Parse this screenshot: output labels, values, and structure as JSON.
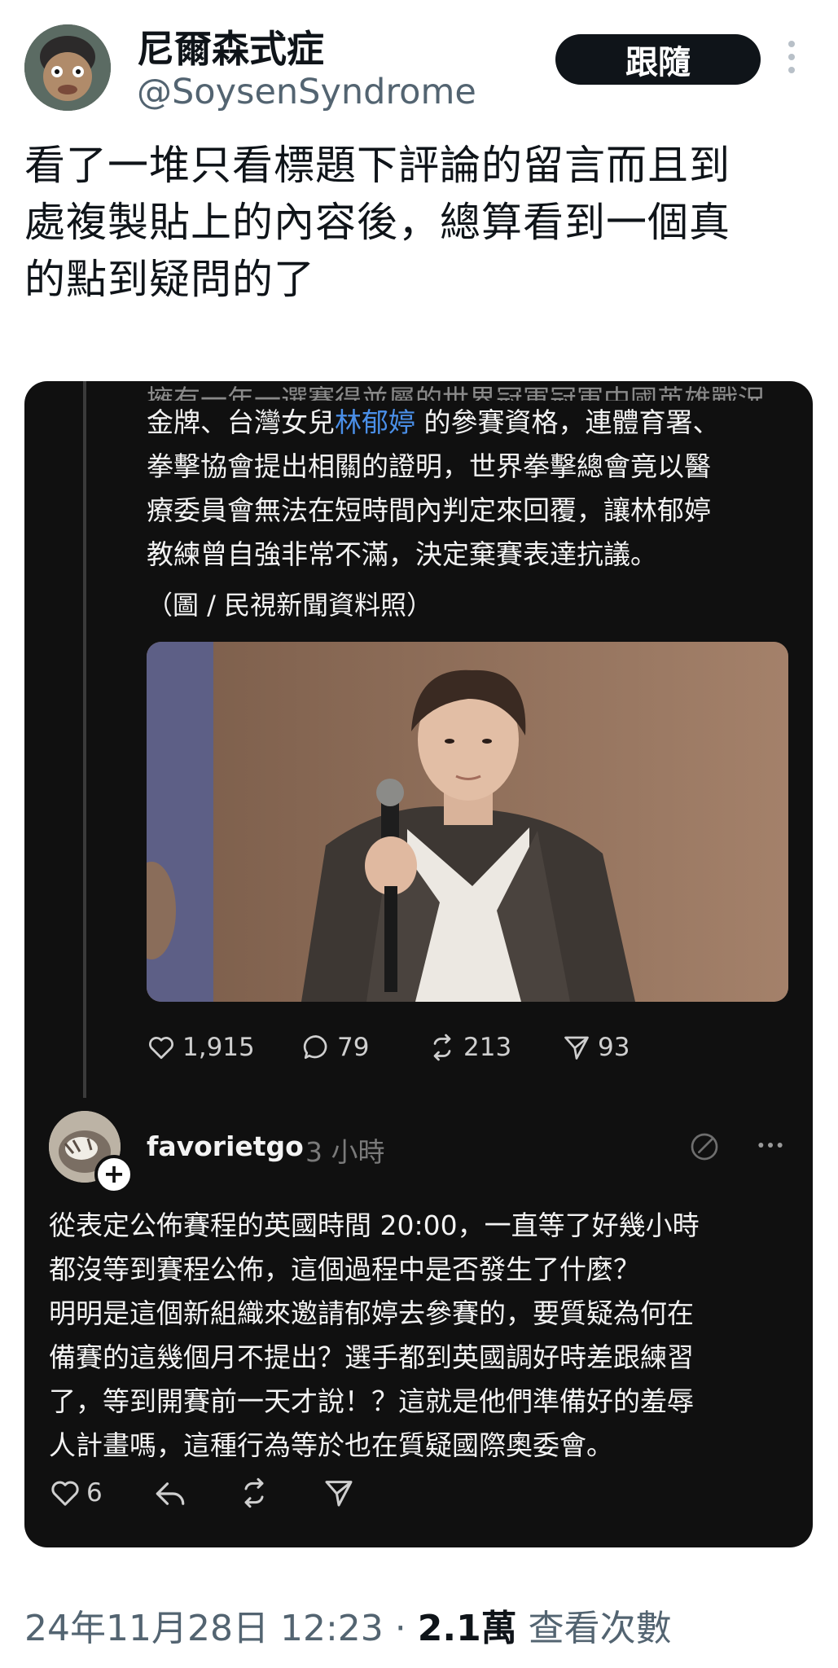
{
  "tweet": {
    "display_name": "尼爾森式症",
    "handle": "@SoysenSyndrome",
    "follow_label": "跟隨",
    "text_lines": [
      "看了一堆只看標題下評論的留言而且到",
      "處複製貼上的內容後，總算看到一個真",
      "的點到疑問的了"
    ]
  },
  "embedded": {
    "post_lines": [
      "金牌、台灣女兒",
      "的參賽資格，連體育署、",
      "拳擊協會提出相關的證明，世界拳擊總會竟以醫",
      "療委員會無法在短時間內判定來回覆，讓林郁婷",
      "教練曾自強非常不滿，決定棄賽表達抗議。"
    ],
    "linked_name": "林郁婷",
    "caption": "（圖 / 民視新聞資料照）",
    "stats": {
      "likes": "1,915",
      "replies": "79",
      "reposts": "213",
      "shares": "93"
    },
    "reply": {
      "username": "favorietgo",
      "time": "3 小時",
      "text_lines": [
        "從表定公佈賽程的英國時間 20:00，一直等了好幾小時",
        "都沒等到賽程公佈，這個過程中是否發生了什麼？",
        "明明是這個新組織來邀請郁婷去參賽的，要質疑為何在",
        "備賽的這幾個月不提出？選手都到英國調好時差跟練習",
        "了，等到開賽前一天才說！？這就是他們準備好的羞辱",
        "人計畫嗎，這種行為等於也在質疑國際奧委會。"
      ],
      "likes": "6"
    }
  },
  "meta": {
    "datetime": "24年11月28日 12:23",
    "separator": " · ",
    "views_count": "2.1萬",
    "views_label": " 查看次數"
  },
  "colors": {
    "follow_bg": "#0f1419",
    "card_bg": "#101010",
    "link": "#4a8fe8",
    "muted": "#536471"
  }
}
